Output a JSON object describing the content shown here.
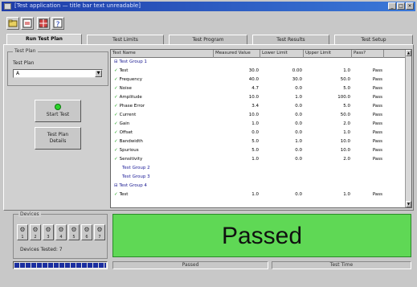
{
  "window": {
    "title": "[Test application — title bar text unreadable]"
  },
  "toolbar": {
    "buttons": [
      "open-icon",
      "config-icon",
      "grid-icon",
      "help-icon"
    ]
  },
  "tabs": [
    {
      "label": "Run Test Plan",
      "active": true
    },
    {
      "label": "Test Limits",
      "active": false
    },
    {
      "label": "Test Program",
      "active": false
    },
    {
      "label": "Test Results",
      "active": false
    },
    {
      "label": "Test Setup",
      "active": false
    }
  ],
  "left": {
    "group_title": "Test Plan",
    "label": "Test Plan",
    "select_value": "A",
    "start_button": "Start Test",
    "detail_button_line1": "Test Plan",
    "detail_button_line2": "Details"
  },
  "grid": {
    "columns": [
      "Test Name",
      "Measured Value",
      "Lower Limit",
      "Upper Limit",
      "Pass?"
    ],
    "rows": [
      {
        "kind": "group",
        "name": "Test Group 1",
        "mv": "",
        "ll": "",
        "ul": "",
        "pf": ""
      },
      {
        "kind": "test",
        "name": "Test",
        "mv": "30.0",
        "ll": "0.00",
        "ul": "1.0",
        "pf": "Pass"
      },
      {
        "kind": "test",
        "name": "Frequency",
        "mv": "40.0",
        "ll": "30.0",
        "ul": "50.0",
        "pf": "Pass"
      },
      {
        "kind": "test",
        "name": "Noise",
        "mv": "4.7",
        "ll": "0.0",
        "ul": "5.0",
        "pf": "Pass"
      },
      {
        "kind": "test",
        "name": "Amplitude",
        "mv": "10.0",
        "ll": "1.0",
        "ul": "100.0",
        "pf": "Pass"
      },
      {
        "kind": "test",
        "name": "Phase Error",
        "mv": "3.4",
        "ll": "0.0",
        "ul": "5.0",
        "pf": "Pass"
      },
      {
        "kind": "test",
        "name": "Current",
        "mv": "10.0",
        "ll": "0.0",
        "ul": "50.0",
        "pf": "Pass"
      },
      {
        "kind": "test",
        "name": "Gain",
        "mv": "1.0",
        "ll": "0.0",
        "ul": "2.0",
        "pf": "Pass"
      },
      {
        "kind": "test",
        "name": "Offset",
        "mv": "0.0",
        "ll": "0.0",
        "ul": "1.0",
        "pf": "Pass"
      },
      {
        "kind": "test",
        "name": "Bandwidth",
        "mv": "5.0",
        "ll": "1.0",
        "ul": "10.0",
        "pf": "Pass"
      },
      {
        "kind": "test",
        "name": "Spurious",
        "mv": "5.0",
        "ll": "0.0",
        "ul": "10.0",
        "pf": "Pass"
      },
      {
        "kind": "test",
        "name": "Sensitivity",
        "mv": "1.0",
        "ll": "0.0",
        "ul": "2.0",
        "pf": "Pass"
      },
      {
        "kind": "sub",
        "name": "Test Group 2",
        "mv": "",
        "ll": "",
        "ul": "",
        "pf": ""
      },
      {
        "kind": "sub",
        "name": "Test Group 3",
        "mv": "",
        "ll": "",
        "ul": "",
        "pf": ""
      },
      {
        "kind": "group",
        "name": "Test Group 4",
        "mv": "",
        "ll": "",
        "ul": "",
        "pf": ""
      },
      {
        "kind": "test",
        "name": "Test",
        "mv": "1.0",
        "ll": "0.0",
        "ul": "1.0",
        "pf": "Pass"
      }
    ]
  },
  "devices": {
    "group_title": "Devices",
    "items": [
      "1",
      "2",
      "3",
      "4",
      "5",
      "6",
      "7"
    ],
    "status": "Devices Tested: 7"
  },
  "result": {
    "text": "Passed",
    "color": "#5fd855"
  },
  "statusbar": {
    "progress": 1.0,
    "center": "Passed",
    "right": "Test Time"
  }
}
